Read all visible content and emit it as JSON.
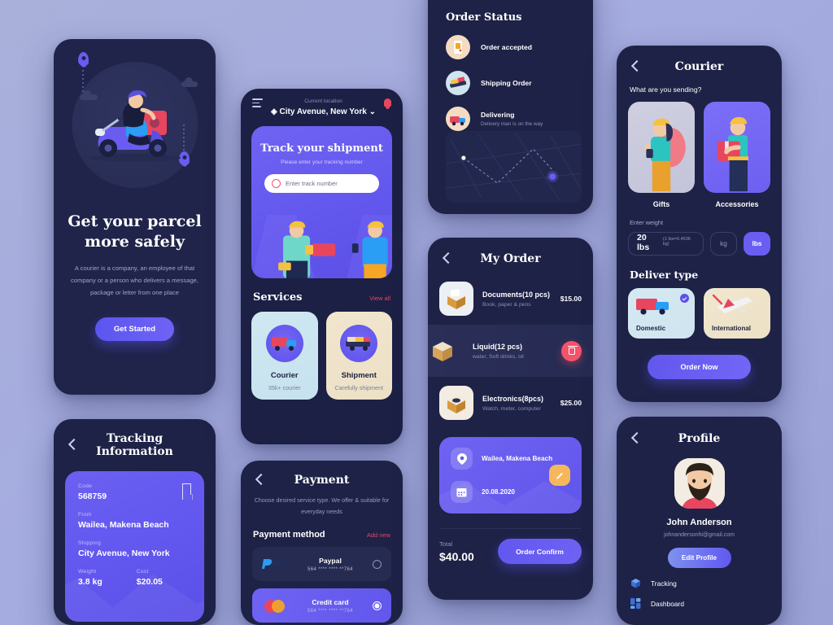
{
  "theme": {
    "background": "#a9b0da",
    "panel_bg": "#1e2246",
    "accent_purple": "#6257ee",
    "accent_red": "#e8455f",
    "accent_amber": "#f6b75c"
  },
  "onboarding": {
    "title_line1": "Get your parcel",
    "title_line2": "more safely",
    "description": "A courier is a company, an employee of that company or a person who delivers a message, package or letter from one place",
    "cta_label": "Get Started"
  },
  "tracking_information": {
    "title": "Tracking Information",
    "code_label": "Code",
    "code_value": "568759",
    "from_label": "From",
    "from_value": "Wailea, Makena Beach",
    "shipping_label": "Shipping",
    "shipping_value": "City Avenue, New York",
    "weight_label": "Weight",
    "weight_value": "3.8 kg",
    "cost_label": "Cost",
    "cost_value": "$20.05"
  },
  "home": {
    "location_caption": "Current location",
    "location_value": "City Avenue, New York",
    "track_title": "Track your shipment",
    "track_note": "Please enter your tracking number",
    "track_placeholder": "Enter track number",
    "services_title": "Services",
    "view_all_label": "View all",
    "services": [
      {
        "name": "Courier",
        "desc": "35k+ courier"
      },
      {
        "name": "Shipment",
        "desc": "Carefully shipment"
      }
    ]
  },
  "payment": {
    "title": "Payment",
    "description": "Choose desired service type. We offer & suitable for everyday needs",
    "method_title": "Payment method",
    "add_new_label": "Add new",
    "methods": [
      {
        "name": "Paypal",
        "number": "564 **** **** **764",
        "selected": false,
        "logo": "paypal-logo"
      },
      {
        "name": "Credit card",
        "number": "564 **** **** **764",
        "selected": true,
        "logo": "mastercard-logo"
      }
    ]
  },
  "order_status": {
    "title": "Order Status",
    "steps": [
      {
        "name": "Order accepted",
        "desc": ""
      },
      {
        "name": "Shipping Order",
        "desc": ""
      },
      {
        "name": "Delivering",
        "desc": "Delivery man is on the way"
      }
    ]
  },
  "my_order": {
    "title": "My Order",
    "items": [
      {
        "name": "Documents(10 pcs)",
        "desc": "Book, paper & pens",
        "price": "$15.00",
        "has_delete": false
      },
      {
        "name": "Liquid(12 pcs)",
        "desc": "water, Soft drinks, oil",
        "price": "",
        "has_delete": true
      },
      {
        "name": "Electronics(8pcs)",
        "desc": "Watch, meter, computer",
        "price": "$25.00",
        "has_delete": false
      }
    ],
    "address": "Wailea, Makena Beach",
    "date": "20.08.2020",
    "total_label": "Total",
    "total_value": "$40.00",
    "confirm_label": "Order Confirm"
  },
  "courier": {
    "title": "Courier",
    "question": "What are you sending?",
    "options": [
      {
        "name": "Gifts"
      },
      {
        "name": "Accessories"
      }
    ],
    "weight_label": "Enter weight",
    "weight_value": "20 lbs",
    "weight_hint": "(1 lbs=0.4536 kg)",
    "unit_kg": "kg",
    "unit_lbs": "lbs",
    "deliver_type_title": "Deliver type",
    "deliver_types": [
      {
        "name": "Domestic",
        "selected": true
      },
      {
        "name": "International",
        "selected": false
      }
    ],
    "order_label": "Order Now"
  },
  "profile": {
    "title": "Profile",
    "name": "John Anderson",
    "email": "johnandersonhi@gmail.com",
    "edit_label": "Edit Profile",
    "menu": [
      {
        "name": "Tracking",
        "icon": "box-icon"
      },
      {
        "name": "Dashboard",
        "icon": "grid-icon"
      }
    ]
  }
}
